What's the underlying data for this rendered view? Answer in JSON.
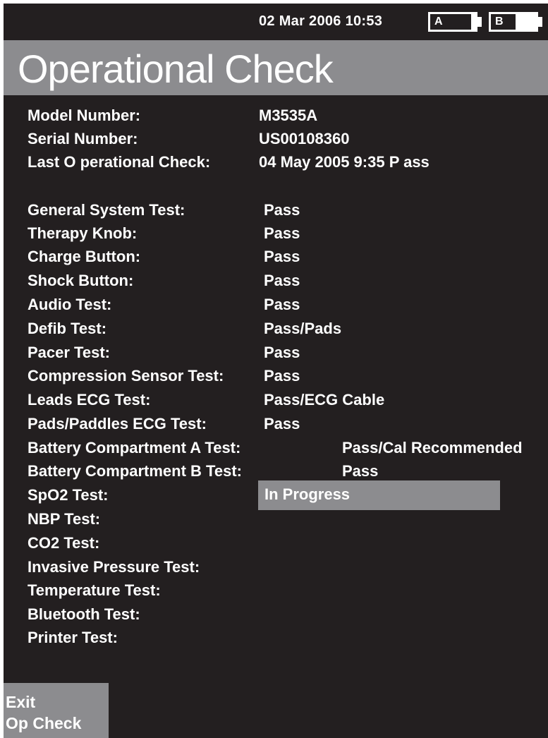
{
  "status_bar": {
    "datetime": "02  Mar  2006  10:53",
    "battery_a": {
      "label": "A",
      "charge_fraction": 0.1
    },
    "battery_b": {
      "label": "B",
      "charge_fraction": 0.45
    }
  },
  "title": "Operational Check",
  "device_info": [
    {
      "label": "Model  Number:",
      "value": "M3535A"
    },
    {
      "label": "Serial  Number:",
      "value": "US00108360"
    },
    {
      "label": "Last O perational  Check:",
      "value": "04  May  2005  9:35  P   ass"
    }
  ],
  "tests": [
    {
      "label": "General System Test:",
      "value": "Pass"
    },
    {
      "label": "Therapy Knob:",
      "value": "Pass"
    },
    {
      "label": "Charge Button:",
      "value": "Pass"
    },
    {
      "label": "Shock Button:",
      "value": "Pass"
    },
    {
      "label": "Audio Test:",
      "value": "Pass"
    },
    {
      "label": "Defib Test:",
      "value": "Pass/Pads"
    },
    {
      "label": "Pacer Test:",
      "value": "Pass"
    },
    {
      "label": "Compression Sensor Test:",
      "value": "Pass"
    },
    {
      "label": "Leads ECG Test:",
      "value": "Pass/ECG Cable"
    },
    {
      "label": "Pads/Paddles ECG Test:",
      "value": "Pass"
    },
    {
      "label": "Battery Compartment A Test:",
      "value": "Pass/Cal Recommended"
    },
    {
      "label": "Battery Compartment B Test:",
      "value": "Pass"
    },
    {
      "label": "SpO2 Test:",
      "value": "In Progress"
    },
    {
      "label": "NBP Test:",
      "value": ""
    },
    {
      "label": "CO2 Test:",
      "value": ""
    },
    {
      "label": "Invasive Pressure Test:",
      "value": ""
    },
    {
      "label": "Temperature Test:",
      "value": ""
    },
    {
      "label": "Bluetooth Test:",
      "value": ""
    },
    {
      "label": "Printer Test:",
      "value": ""
    }
  ],
  "softkey": {
    "line1": "Exit",
    "line2": "Op  Check"
  },
  "colors": {
    "background": "#231f20",
    "bar": "#8c8c8f",
    "text": "#ffffff"
  }
}
